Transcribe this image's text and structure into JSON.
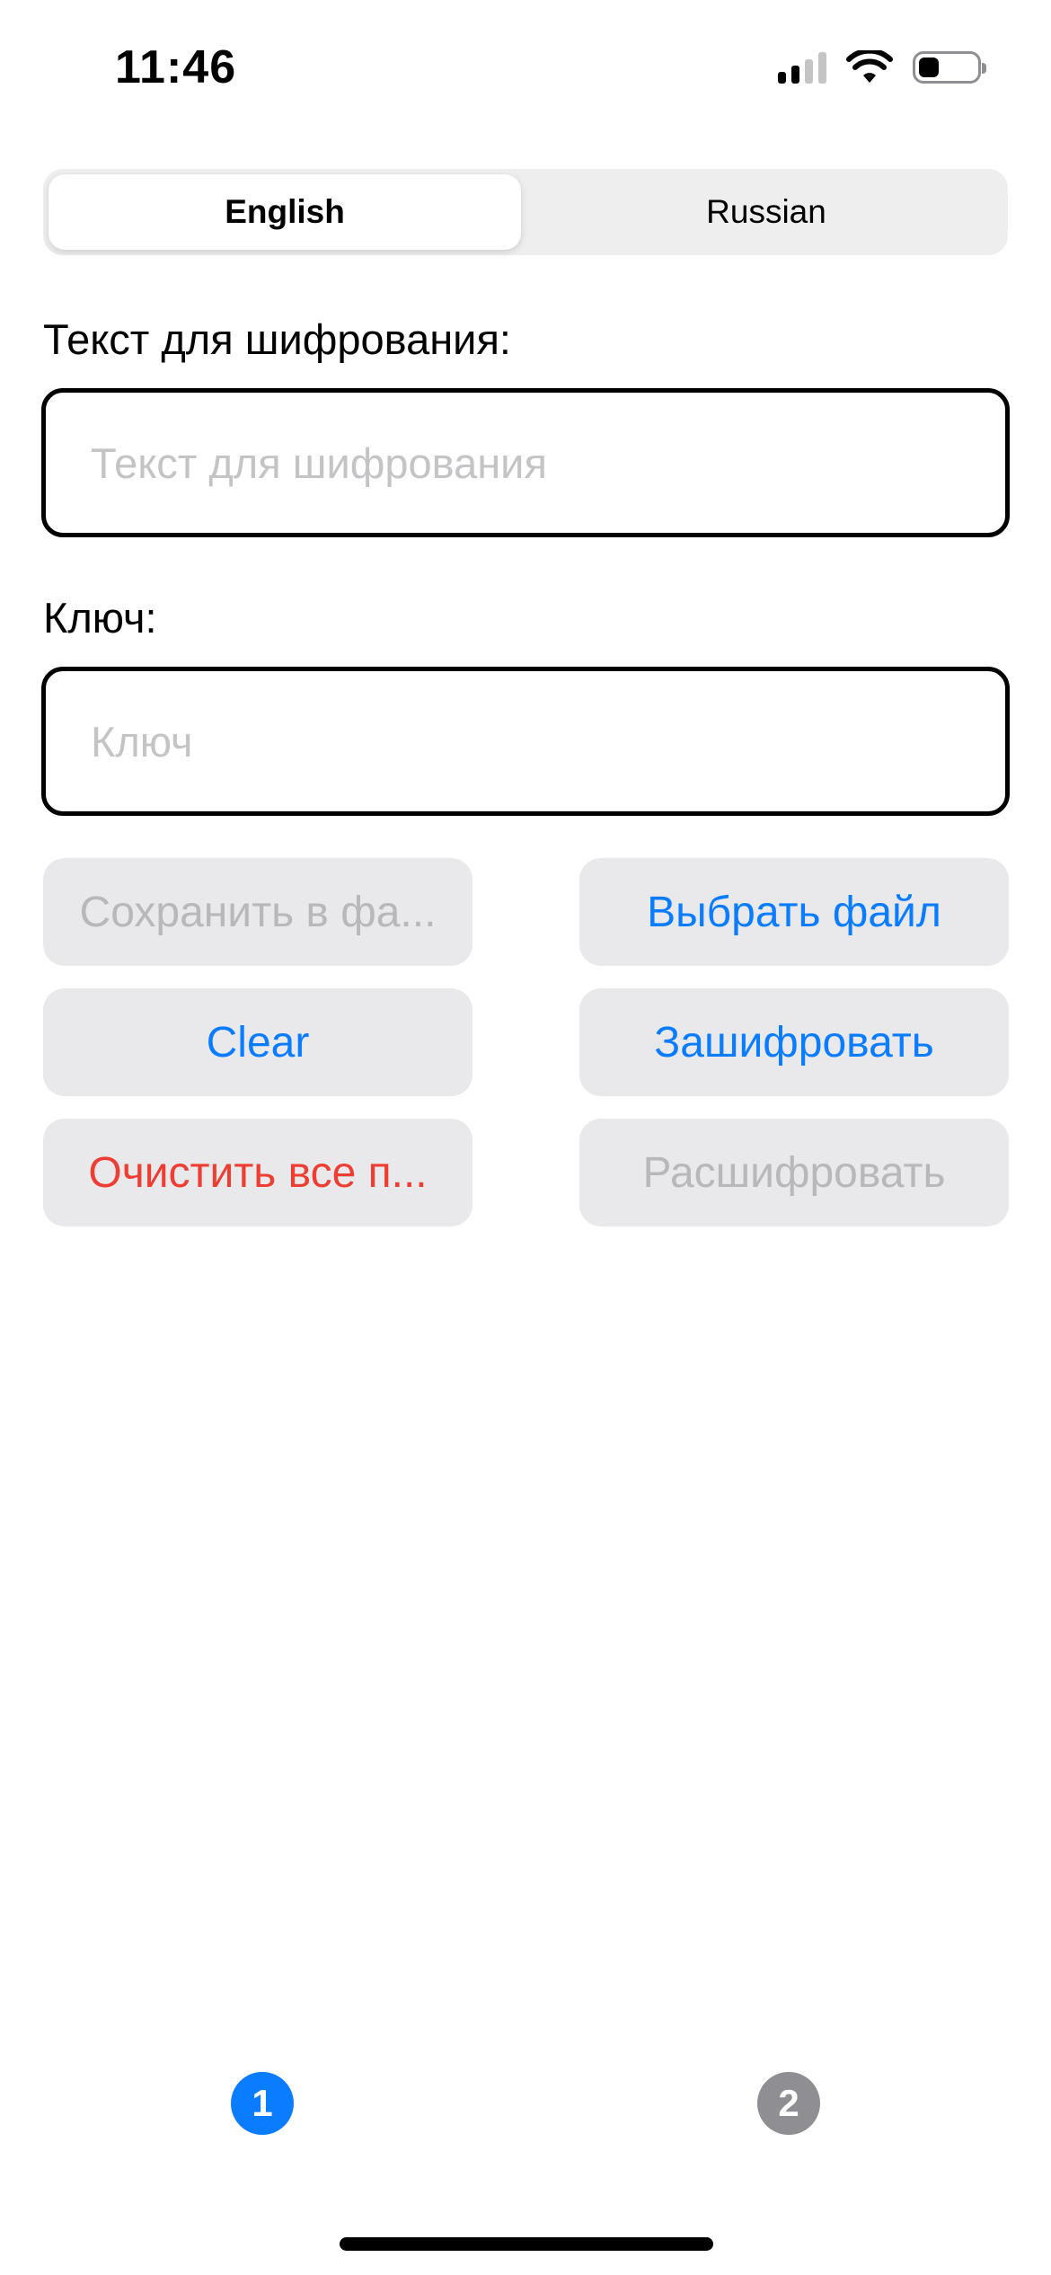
{
  "status_bar": {
    "time": "11:46",
    "signal_bars_active": 2,
    "signal_bars_total": 4,
    "battery_level": 0.35
  },
  "language_switch": {
    "options": [
      "English",
      "Russian"
    ],
    "selected": "English"
  },
  "cipher_text": {
    "label": "Текст для шифрования:",
    "placeholder": "Текст для шифрования",
    "value": ""
  },
  "key": {
    "label": "Ключ:",
    "placeholder": "Ключ",
    "value": ""
  },
  "buttons": {
    "save_to_file": "Сохранить в фа...",
    "choose_file": "Выбрать файл",
    "clear": "Clear",
    "encrypt": "Зашифровать",
    "clear_all": "Очистить все п...",
    "decrypt": "Расшифровать"
  },
  "pages": {
    "items": [
      "1",
      "2"
    ],
    "active": "1"
  },
  "colors": {
    "accent_blue": "#0a7cff",
    "destructive_red": "#ee3e33",
    "disabled_grey": "#b8b8bb",
    "button_bg": "#e9e9eb",
    "page_active": "#0a7cff",
    "page_inactive": "#8e8e93"
  },
  "icons": {
    "signal": "cellular-signal-icon",
    "wifi": "wifi-icon",
    "battery": "battery-icon"
  }
}
